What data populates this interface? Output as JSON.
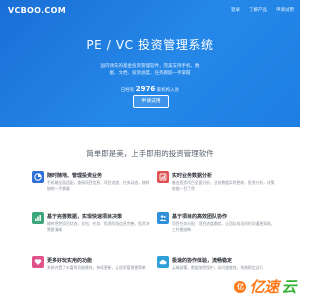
{
  "header": {
    "logo": "VCBOO.COM",
    "nav": [
      "登录",
      "了解产品",
      "申请试用"
    ]
  },
  "hero": {
    "title": "PE / VC 投资管理系统",
    "description": "国内领先的基金投资管理软件，完美支持手机、数据、文档、投资进度、任务跟踪一手掌握",
    "count_prefix": "已经有",
    "count_value": "2976",
    "count_suffix": "家机构入驻",
    "cta": "申请试用"
  },
  "features_section": {
    "title": "简单即是美，上手即用的投资管理软件",
    "items": [
      {
        "icon": "pie-chart-icon",
        "color": "#2f6fd8",
        "title": "随时随地、管理投资业务",
        "desc": "手机端全面适配，查阅项目信息、项目进度、任务动态，随时随地一手掌握"
      },
      {
        "icon": "cloud-data-icon",
        "color": "#e05252",
        "title": "实时业务数据分析",
        "desc": "基金投资项目全面分析，业务数据实时更新，投资分析，决策依据一目了然"
      },
      {
        "icon": "bar-chart-icon",
        "color": "#3aa67a",
        "title": "基于完善数据，实现快速项目决策",
        "desc": "随时把控项目状态，文档、任务、投资阶段信息完善，投资决策更清晰"
      },
      {
        "icon": "team-icon",
        "color": "#2f8fd8",
        "title": "基于项目的高效团队协作",
        "desc": "项目任务分配、项目进度跟踪，让团队成员间的沟通更高效，工作更顺畅"
      },
      {
        "icon": "heart-icon",
        "color": "#e0528a",
        "title": "更多好玩实用的功能",
        "desc": "系统内置了丰富的功能模块，持续更新，让投资管理更简单"
      },
      {
        "icon": "cloud-icon",
        "color": "#2f9fd8",
        "title": "极速的协作体验，流畅稳定",
        "desc": "云端部署，数据加密保护，访问速度快，系统稳定运行"
      }
    ]
  },
  "watermark": {
    "text_orange": "亿速",
    "text_green": "云",
    "badge": "亿"
  }
}
